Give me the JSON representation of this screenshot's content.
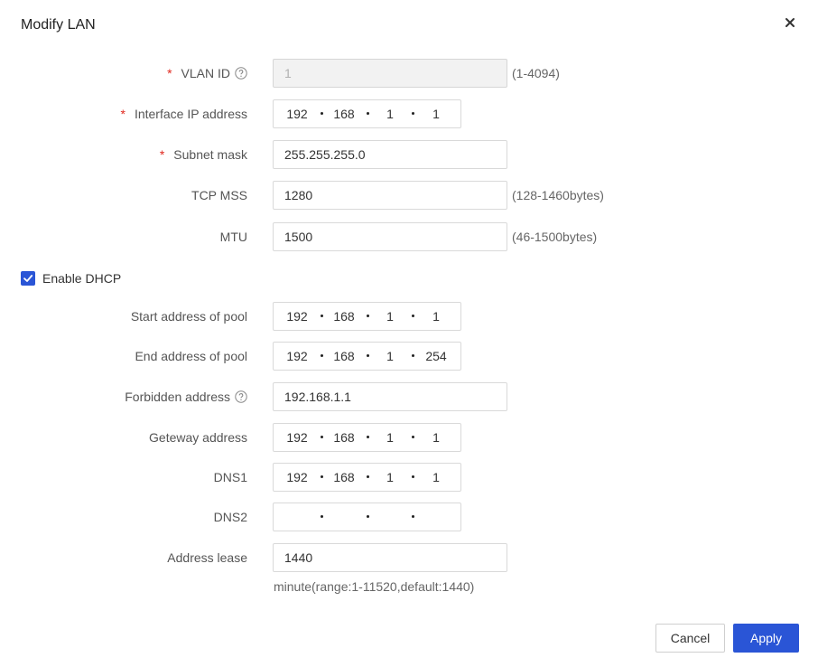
{
  "dialog": {
    "title": "Modify LAN",
    "close_glyph": "×"
  },
  "fields": {
    "vlan_id": {
      "label": "VLAN ID",
      "required": "*",
      "value": "1",
      "hint": "(1-4094)"
    },
    "interface_ip": {
      "label": "Interface IP address",
      "required": "*",
      "octets": [
        "192",
        "168",
        "1",
        "1"
      ]
    },
    "subnet_mask": {
      "label": "Subnet mask",
      "required": "*",
      "value": "255.255.255.0"
    },
    "tcp_mss": {
      "label": "TCP MSS",
      "value": "1280",
      "hint": "(128-1460bytes)"
    },
    "mtu": {
      "label": "MTU",
      "value": "1500",
      "hint": "(46-1500bytes)"
    }
  },
  "dhcp": {
    "enable_label": "Enable DHCP",
    "enabled": true,
    "start_pool": {
      "label": "Start address of pool",
      "octets": [
        "192",
        "168",
        "1",
        "1"
      ]
    },
    "end_pool": {
      "label": "End address of pool",
      "octets": [
        "192",
        "168",
        "1",
        "254"
      ]
    },
    "forbidden": {
      "label": "Forbidden address",
      "value": "192.168.1.1"
    },
    "gateway": {
      "label": "Geteway address",
      "octets": [
        "192",
        "168",
        "1",
        "1"
      ]
    },
    "dns1": {
      "label": "DNS1",
      "octets": [
        "192",
        "168",
        "1",
        "1"
      ]
    },
    "dns2": {
      "label": "DNS2",
      "octets": [
        "",
        "",
        "",
        ""
      ]
    },
    "lease": {
      "label": "Address lease",
      "value": "1440",
      "note": "minute(range:1-11520,default:1440)"
    }
  },
  "buttons": {
    "cancel": "Cancel",
    "apply": "Apply"
  },
  "colors": {
    "accent": "#2a55d6",
    "required": "#e0281e"
  }
}
